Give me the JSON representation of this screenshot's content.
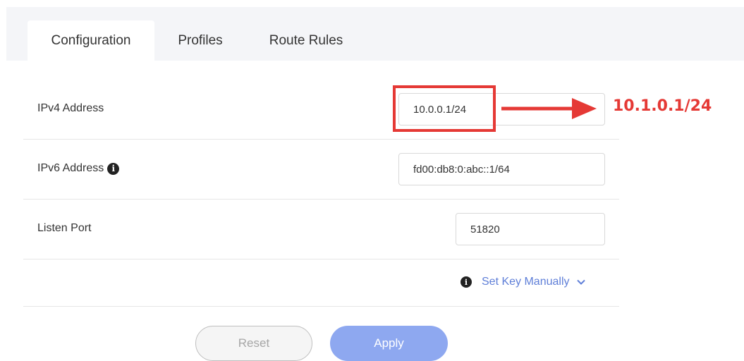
{
  "tabs": [
    {
      "label": "Configuration",
      "active": true
    },
    {
      "label": "Profiles",
      "active": false
    },
    {
      "label": "Route Rules",
      "active": false
    }
  ],
  "fields": {
    "ipv4": {
      "label": "IPv4 Address",
      "value": "10.0.0.1/24"
    },
    "ipv6": {
      "label": "IPv6 Address",
      "value": "fd00:db8:0:abc::1/64",
      "info_icon": "info-circle"
    },
    "port": {
      "label": "Listen Port",
      "value": "51820"
    }
  },
  "set_key": {
    "label": "Set Key Manually",
    "icon": "info-circle",
    "chevron": "chevron-down"
  },
  "buttons": {
    "reset": "Reset",
    "apply": "Apply"
  },
  "annotation": {
    "text": "10.1.0.1/24",
    "color": "#e53935"
  },
  "colors": {
    "accent": "#5f7fd8",
    "apply_button": "#8ea8f0",
    "tab_bar": "#f4f5f8"
  }
}
